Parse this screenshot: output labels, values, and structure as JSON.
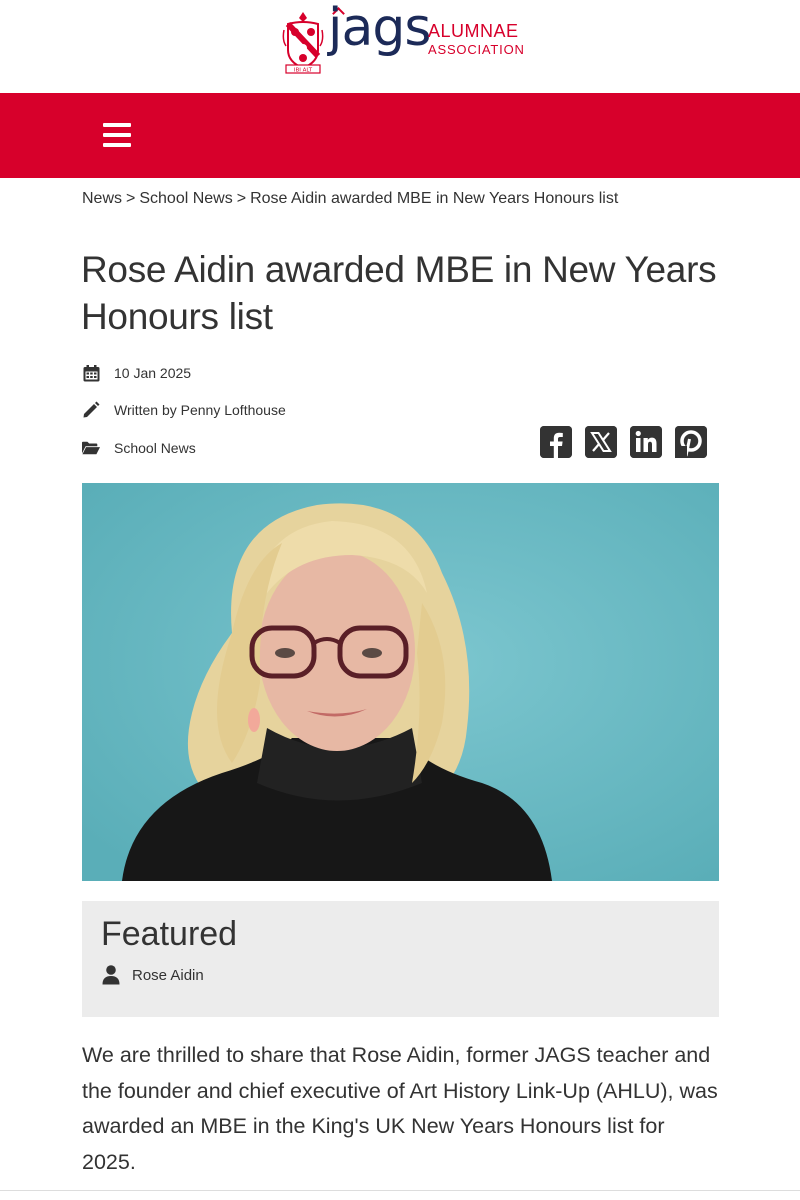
{
  "header": {
    "logo": {
      "wordmark": "jags",
      "line1": "ALUMNAE",
      "line2": "ASSOCIATION",
      "crest_motto": "IBI ALT"
    }
  },
  "nav": {
    "menu_icon": "hamburger-icon"
  },
  "breadcrumb": {
    "items": [
      "News",
      "School News",
      "Rose Aidin awarded MBE in New Years Honours list"
    ],
    "separator": ">"
  },
  "article": {
    "title": "Rose Aidin awarded MBE in New Years Honours list",
    "date": "10 Jan 2025",
    "author": "Written by Penny Lofthouse",
    "category": "School News"
  },
  "share": {
    "icons": [
      "facebook-icon",
      "x-icon",
      "linkedin-icon",
      "pinterest-icon"
    ]
  },
  "featured": {
    "heading": "Featured",
    "person": "Rose Aidin"
  },
  "body": {
    "paragraph": "We are thrilled to share that Rose Aidin, former JAGS teacher and the founder and chief executive of Art History Link-Up (AHLU), was awarded an MBE in the King's UK New Years Honours list for 2025."
  },
  "colors": {
    "brand_red": "#d7002b",
    "brand_navy": "#1c2a58",
    "text": "#333333",
    "featured_bg": "#ececec",
    "photo_bg": "#6dbbc5"
  }
}
